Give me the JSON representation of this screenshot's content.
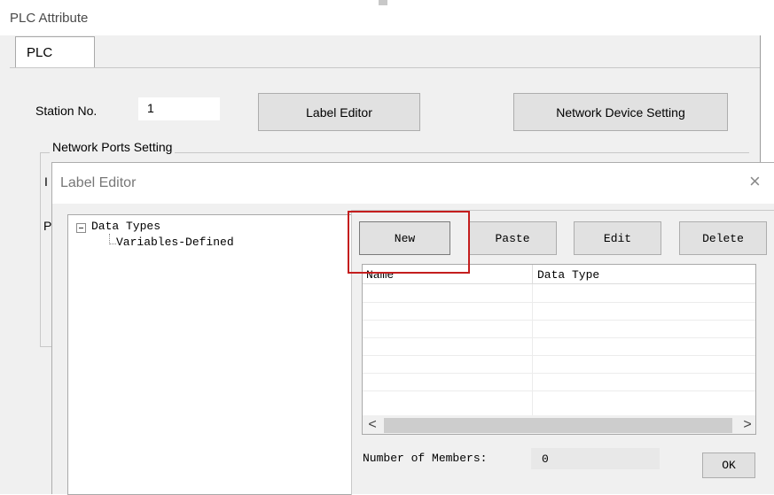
{
  "plc_dialog": {
    "title": "PLC Attribute",
    "tab": "PLC",
    "station_label": "Station No.",
    "station_value": "1",
    "label_editor_button": "Label Editor",
    "network_device_button": "Network Device Setting",
    "ports_group_label": "Network Ports Setting",
    "partial_label_1": "I",
    "partial_label_2": "P"
  },
  "label_editor": {
    "title": "Label Editor",
    "close_glyph": "×",
    "tree": {
      "root": "Data Types",
      "children": [
        "Variables-Defined"
      ]
    },
    "buttons": {
      "new": "New",
      "paste": "Paste",
      "edit": "Edit",
      "delete": "Delete"
    },
    "table": {
      "columns": [
        "Name",
        "Data Type"
      ],
      "rows": []
    },
    "scroll_left": "<",
    "scroll_right": ">",
    "members_label": "Number of Members:",
    "members_count": "0",
    "ok_button": "OK"
  },
  "colors": {
    "highlight": "#c41e1e",
    "dialog_bg": "#f0f0f0"
  }
}
